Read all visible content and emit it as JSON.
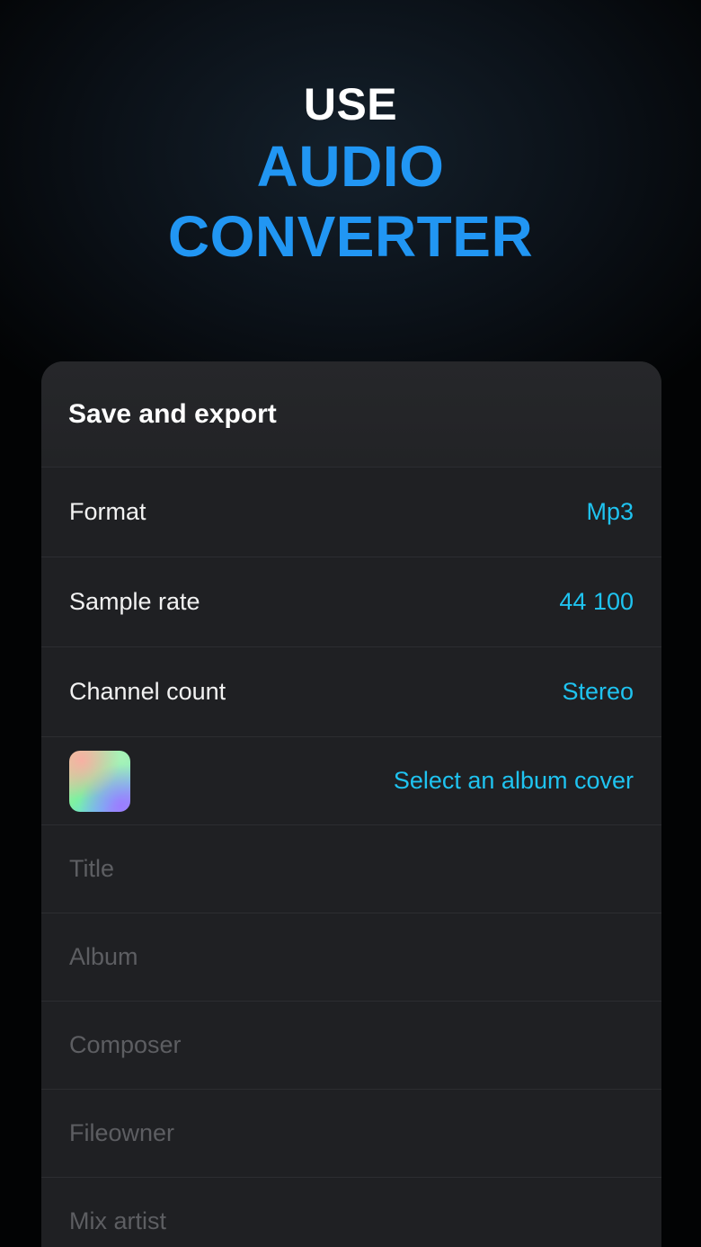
{
  "hero": {
    "line1": "USE",
    "line2": "AUDIO",
    "line3": "CONVERTER"
  },
  "panel": {
    "title": "Save and export",
    "settings": [
      {
        "label": "Format",
        "value": "Mp3"
      },
      {
        "label": "Sample rate",
        "value": "44 100"
      },
      {
        "label": "Channel count",
        "value": "Stereo"
      }
    ],
    "cover": {
      "action_label": "Select an album cover"
    },
    "fields": [
      {
        "placeholder": "Title",
        "value": ""
      },
      {
        "placeholder": "Album",
        "value": ""
      },
      {
        "placeholder": "Composer",
        "value": ""
      },
      {
        "placeholder": "Fileowner",
        "value": ""
      },
      {
        "placeholder": "Mix artist",
        "value": ""
      }
    ]
  },
  "colors": {
    "accent_heading": "#2196f3",
    "accent_value": "#1fc3f0",
    "card_background": "#1f2023",
    "placeholder": "#5d5e62"
  }
}
